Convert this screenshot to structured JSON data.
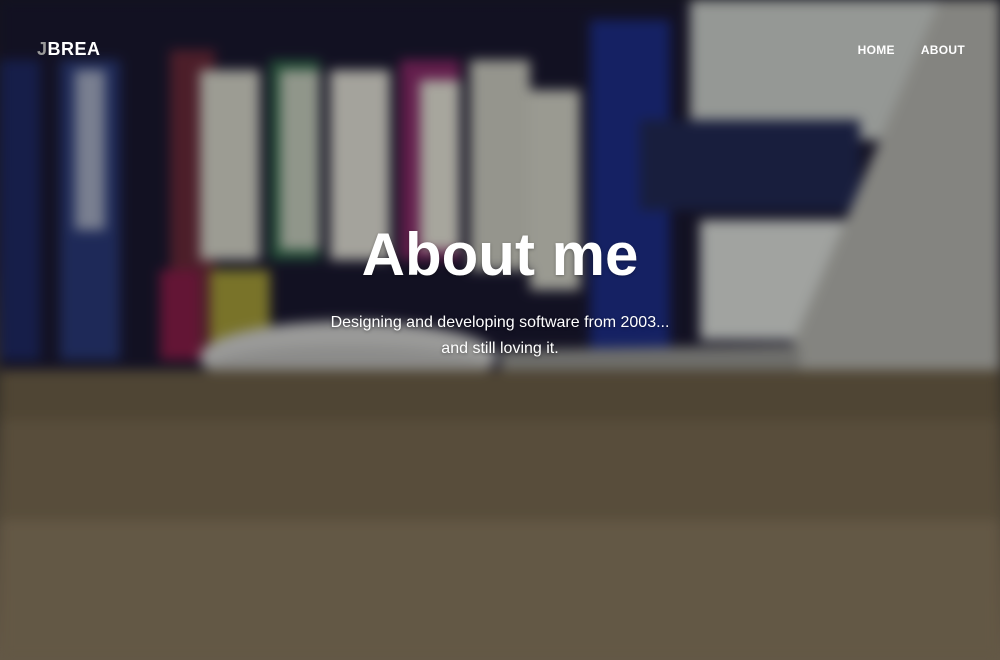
{
  "navbar": {
    "brand_first": "J",
    "brand_rest": "BREA",
    "links": [
      {
        "label": "HOME"
      },
      {
        "label": "ABOUT"
      }
    ]
  },
  "header": {
    "title": "About me",
    "subtitle_line1": "Designing and developing software from 2003...",
    "subtitle_line2": "and still loving it."
  }
}
